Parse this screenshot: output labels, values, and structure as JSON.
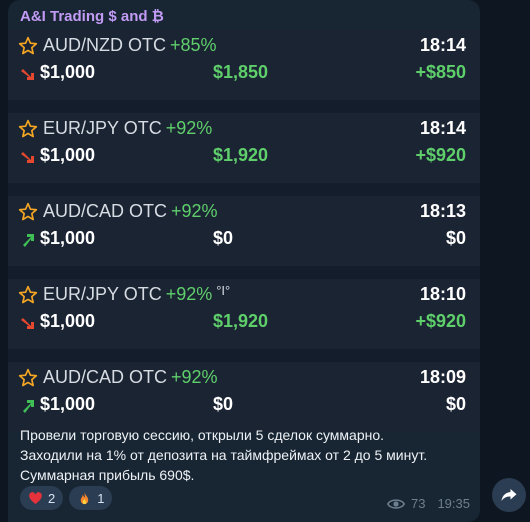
{
  "channel": {
    "title": "A&I Trading $ and ₿"
  },
  "trades": [
    {
      "pair": "AUD/NZD OTC",
      "percent": "+85%",
      "marker": "",
      "time": "18:14",
      "direction": "down",
      "stake": "$1,000",
      "payout": "$1,850",
      "profit": "+$850",
      "result": "win"
    },
    {
      "pair": "EUR/JPY OTC",
      "percent": "+92%",
      "marker": "",
      "time": "18:14",
      "direction": "down",
      "stake": "$1,000",
      "payout": "$1,920",
      "profit": "+$920",
      "result": "win"
    },
    {
      "pair": "AUD/CAD OTC",
      "percent": "+92%",
      "marker": "",
      "time": "18:13",
      "direction": "up",
      "stake": "$1,000",
      "payout": "$0",
      "profit": "$0",
      "result": "zero"
    },
    {
      "pair": "EUR/JPY OTC",
      "percent": "+92%",
      "marker": "°I°",
      "time": "18:10",
      "direction": "down",
      "stake": "$1,000",
      "payout": "$1,920",
      "profit": "+$920",
      "result": "win"
    },
    {
      "pair": "AUD/CAD OTC",
      "percent": "+92%",
      "marker": "",
      "time": "18:09",
      "direction": "up",
      "stake": "$1,000",
      "payout": "$0",
      "profit": "$0",
      "result": "zero"
    }
  ],
  "caption": {
    "line1": "Провели торговую сессию, открыли 5 сделок суммарно.",
    "line2": "Заходили на 1% от депозита на таймфреймах от 2 до 5 минут.",
    "line3": "Суммарная прибыль 690$."
  },
  "reactions": [
    {
      "icon": "heart-icon",
      "count": "2"
    },
    {
      "icon": "fire-icon",
      "count": "1"
    }
  ],
  "meta": {
    "views": "73",
    "time": "19:35"
  },
  "colors": {
    "win": "#5fcf6b",
    "arrow_down": "#e5482f",
    "arrow_up": "#3fbf55",
    "star": "#f5a623",
    "channel_title": "#c29bf5"
  }
}
